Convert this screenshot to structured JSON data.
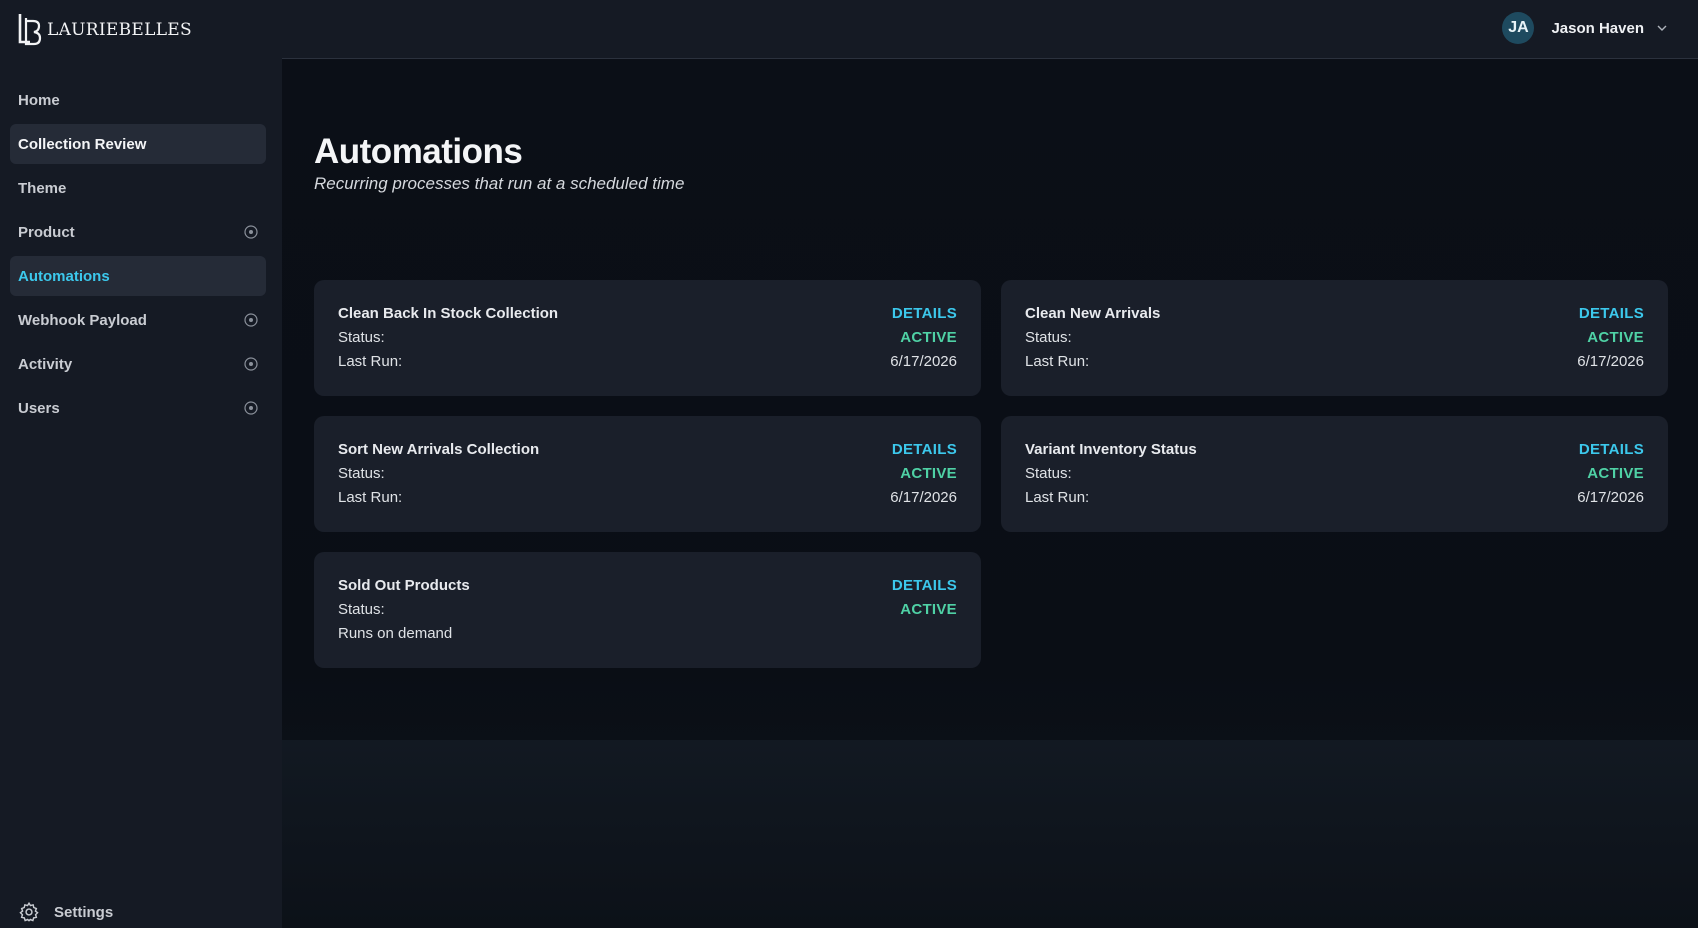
{
  "app": {
    "logo_text": "LAURIEBELLES",
    "logo_icon": "lb-monogram-icon"
  },
  "sidebar": {
    "items": [
      {
        "label": "Home",
        "state": "normal",
        "expandable": false
      },
      {
        "label": "Collection Review",
        "state": "selected",
        "expandable": false
      },
      {
        "label": "Theme",
        "state": "normal",
        "expandable": false
      },
      {
        "label": "Product",
        "state": "normal",
        "expandable": true
      },
      {
        "label": "Automations",
        "state": "active",
        "expandable": false
      },
      {
        "label": "Webhook Payload",
        "state": "normal",
        "expandable": true
      },
      {
        "label": "Activity",
        "state": "normal",
        "expandable": true
      },
      {
        "label": "Users",
        "state": "normal",
        "expandable": true
      }
    ],
    "settings_label": "Settings",
    "settings_icon": "gear-icon"
  },
  "header": {
    "user": {
      "initials": "JA",
      "name": "Jason Haven",
      "menu_icon": "chevron-down-icon"
    }
  },
  "main": {
    "title": "Automations",
    "subtitle": "Recurring processes that run at a scheduled time",
    "automations": [
      {
        "name": "Clean Back In Stock Collection",
        "details_label": "DETAILS",
        "status_label": "Status:",
        "status": "ACTIVE",
        "run_label": "Last Run:",
        "run_value": "6/17/2026"
      },
      {
        "name": "Clean New Arrivals",
        "details_label": "DETAILS",
        "status_label": "Status:",
        "status": "ACTIVE",
        "run_label": "Last Run:",
        "run_value": "6/17/2026"
      },
      {
        "name": "Sort New Arrivals Collection",
        "details_label": "DETAILS",
        "status_label": "Status:",
        "status": "ACTIVE",
        "run_label": "Last Run:",
        "run_value": "6/17/2026"
      },
      {
        "name": "Variant Inventory Status",
        "details_label": "DETAILS",
        "status_label": "Status:",
        "status": "ACTIVE",
        "run_label": "Last Run:",
        "run_value": "6/17/2026"
      },
      {
        "name": "Sold Out Products",
        "details_label": "DETAILS",
        "status_label": "Status:",
        "status": "ACTIVE",
        "run_label": "Runs on demand",
        "run_value": ""
      }
    ]
  },
  "colors": {
    "accent": "#3cc8ec",
    "status_active": "#4fd1a5",
    "sidebar_bg": "#151a24",
    "card_bg": "#1a1f2a"
  }
}
